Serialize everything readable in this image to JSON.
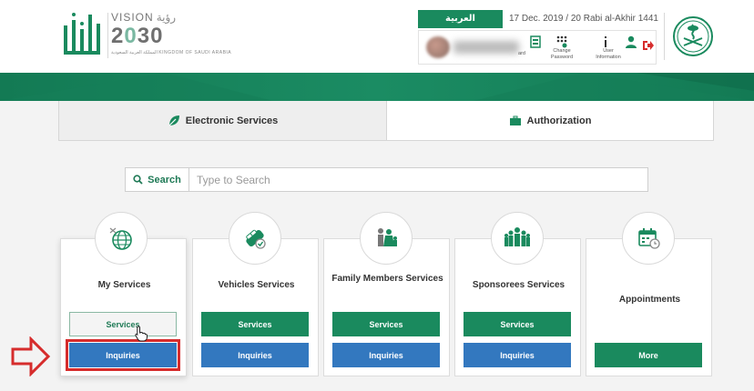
{
  "header": {
    "vision": {
      "label_en": "VISION",
      "label_ar": "رؤية",
      "year_prefix": "2",
      "year_zero": "0",
      "year_suffix": "30",
      "subtitle": "المملكة العربية السعودية KINGDOM OF SAUDI ARABIA"
    },
    "language_button": "العربية",
    "date": "17 Dec. 2019 / 20 Rabi al-Akhir 1441",
    "toolbar": {
      "dashboard_label": "ard",
      "change_password_label_1": "Change",
      "change_password_label_2": "Password",
      "user_information_label_1": "User",
      "user_information_label_2": "Information"
    }
  },
  "tabs": [
    {
      "label": "Electronic Services",
      "icon": "leaf-icon"
    },
    {
      "label": "Authorization",
      "icon": "briefcase-icon"
    }
  ],
  "search": {
    "button_label": "Search",
    "placeholder": "Type to Search"
  },
  "cards": [
    {
      "title": "My Services",
      "icon": "globe-icon",
      "primary": "Services",
      "secondary": "Inquiries"
    },
    {
      "title": "Vehicles Services",
      "icon": "car-icon",
      "primary": "Services",
      "secondary": "Inquiries"
    },
    {
      "title": "Family Members Services",
      "icon": "family-icon",
      "primary": "Services",
      "secondary": "Inquiries"
    },
    {
      "title": "Sponsorees Services",
      "icon": "group-icon",
      "primary": "Services",
      "secondary": "Inquiries"
    },
    {
      "title": "Appointments",
      "icon": "calendar-clock-icon",
      "primary": "More"
    }
  ],
  "colors": {
    "brand_green": "#1a8a5e",
    "brand_blue": "#3378bf",
    "highlight_red": "#d62c2c"
  }
}
